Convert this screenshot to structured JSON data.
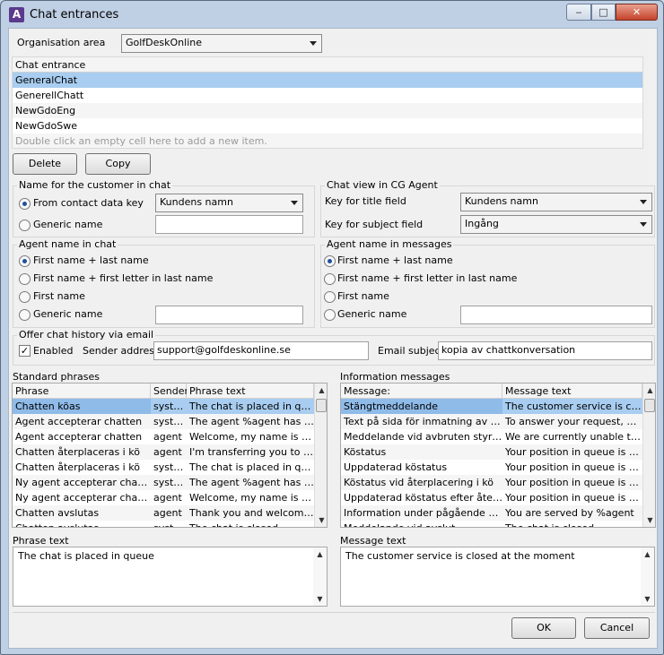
{
  "window": {
    "title": "Chat entrances",
    "buttons": {
      "min": "‒",
      "max": "□",
      "close": "✕"
    }
  },
  "org": {
    "label": "Organisation area",
    "value": "GolfDeskOnline"
  },
  "entrances": {
    "header": "Chat entrance",
    "items": [
      "GeneralChat",
      "GenerellChatt",
      "NewGdoEng",
      "NewGdoSwe"
    ],
    "placeholder": "Double click an empty cell here to add a new item."
  },
  "actions": {
    "delete": "Delete",
    "copy": "Copy"
  },
  "customer_name": {
    "title": "Name for the customer in chat",
    "option1": "From contact data key",
    "option1_value": "Kundens namn",
    "option2": "Generic name",
    "option2_value": ""
  },
  "chat_view": {
    "title": "Chat view in CG Agent",
    "title_field_label": "Key for title field",
    "title_field_value": "Kundens namn",
    "subject_field_label": "Key for subject field",
    "subject_field_value": "Ingång"
  },
  "agent_chat": {
    "title": "Agent name in chat",
    "options": [
      "First name + last name",
      "First name + first letter in last name",
      "First name",
      "Generic name"
    ],
    "generic_value": ""
  },
  "agent_messages": {
    "title": "Agent name in messages",
    "options": [
      "First name + last name",
      "First name + first letter in last name",
      "First name",
      "Generic name"
    ],
    "generic_value": ""
  },
  "history": {
    "title": "Offer chat history via email",
    "enabled_label": "Enabled",
    "sender_label": "Sender address",
    "sender_value": "support@golfdeskonline.se",
    "subject_label": "Email subject",
    "subject_value": "kopia av chattkonversation"
  },
  "phrases": {
    "title": "Standard phrases",
    "columns": [
      "Phrase",
      "Sender",
      "Phrase text"
    ],
    "rows": [
      [
        "Chatten köas",
        "system",
        "The chat is placed in queue"
      ],
      [
        "Agent accepterar chatten",
        "system",
        "The agent %agent has en..."
      ],
      [
        "Agent accepterar chatten",
        "agent",
        "Welcome, my name is %a..."
      ],
      [
        "Chatten återplaceras i kö",
        "agent",
        "I'm transferring you to an..."
      ],
      [
        "Chatten återplaceras i kö",
        "system",
        "The chat is placed in queu..."
      ],
      [
        "Ny agent accepterar chatten",
        "system",
        "The agent %agent has en..."
      ],
      [
        "Ny agent accepterar chatte...",
        "agent",
        "Welcome, my name is %a..."
      ],
      [
        "Chatten avslutas",
        "agent",
        "Thank you and welcome b..."
      ],
      [
        "Chatten avslutas",
        "system",
        "The chat is closed"
      ]
    ],
    "text_label": "Phrase text",
    "text_value": "The chat is placed in queue"
  },
  "info": {
    "title": "Information messages",
    "columns": [
      "Message:",
      "Message text"
    ],
    "rows": [
      [
        "Stängtmeddelande",
        "The customer service is close..."
      ],
      [
        "Text på sida för inmatning av upp...",
        "To answer your request, ple..."
      ],
      [
        "Meddelande vid avbruten styrning",
        "We are currently unable to s..."
      ],
      [
        "Köstatus",
        "Your position in queue is %p..."
      ],
      [
        "Uppdaterad köstatus",
        "Your position in queue is %pos"
      ],
      [
        "Köstatus vid återplacering i kö",
        "Your position in queue is %p..."
      ],
      [
        "Uppdaterad köstatus efter återpl...",
        "Your position in queue is %p..."
      ],
      [
        "Information under pågående chatt",
        "You are served by %agent"
      ],
      [
        "Meddelande vid avslut",
        "The chat is closed"
      ]
    ],
    "text_label": "Message text",
    "text_value": "The customer service is closed at the moment"
  },
  "footer": {
    "ok": "OK",
    "cancel": "Cancel"
  }
}
